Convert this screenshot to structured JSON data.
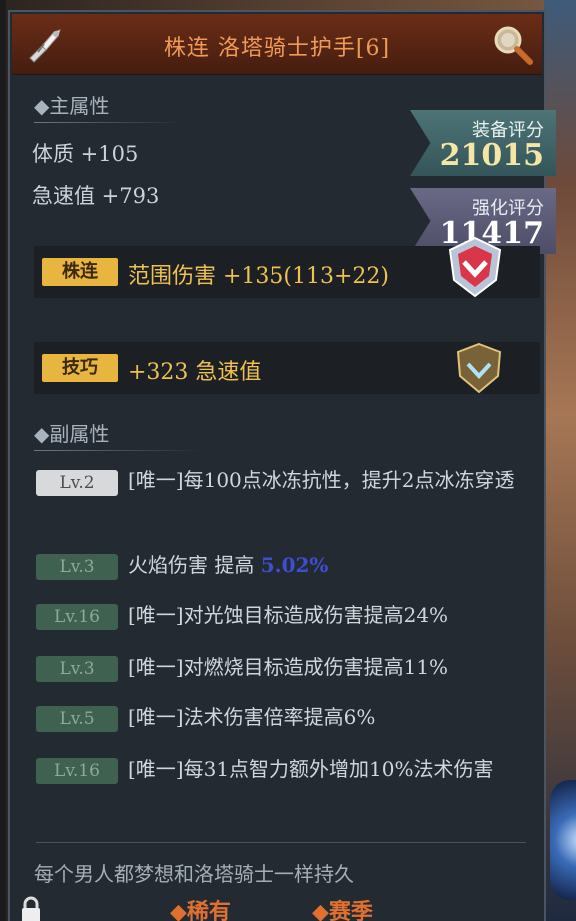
{
  "header": {
    "title": "株连 洛塔骑士护手[6]"
  },
  "main_attributes": {
    "label": "◆主属性",
    "stats": [
      "体质 +105",
      "急速值 +793"
    ]
  },
  "scores": {
    "equip": {
      "label": "装备评分",
      "value": "21015"
    },
    "enhance": {
      "label": "强化评分",
      "value": "11417"
    }
  },
  "affixes": [
    {
      "tag": "株连",
      "text": "范围伤害 +135(113+22)"
    },
    {
      "tag": "技巧",
      "text": "+323 急速值"
    }
  ],
  "sub_attributes": {
    "label": "◆副属性",
    "items": [
      {
        "level": "Lv.2",
        "text": "[唯一]每100点冰冻抗性，提升2点冰冻穿透"
      },
      {
        "level": "Lv.3",
        "text_before": "火焰伤害 提高 ",
        "highlight": "5.02%"
      },
      {
        "level": "Lv.16",
        "text": "[唯一]对光蚀目标造成伤害提高24%"
      },
      {
        "level": "Lv.3",
        "text": "[唯一]对燃烧目标造成伤害提高11%"
      },
      {
        "level": "Lv.5",
        "text": "[唯一]法术伤害倍率提高6%"
      },
      {
        "level": "Lv.16",
        "text": "[唯一]每31点智力额外增加10%法术伤害"
      }
    ]
  },
  "flavor_text": "每个男人都梦想和洛塔骑士一样持久",
  "footer": {
    "rarity": "◆稀有",
    "season": "◆赛季"
  },
  "colors": {
    "header_bg": "#5a2614",
    "title": "#f09a55",
    "affix_tag": "#e8b540",
    "affix_text": "#f0c050",
    "highlight": "#3d4fd0"
  }
}
